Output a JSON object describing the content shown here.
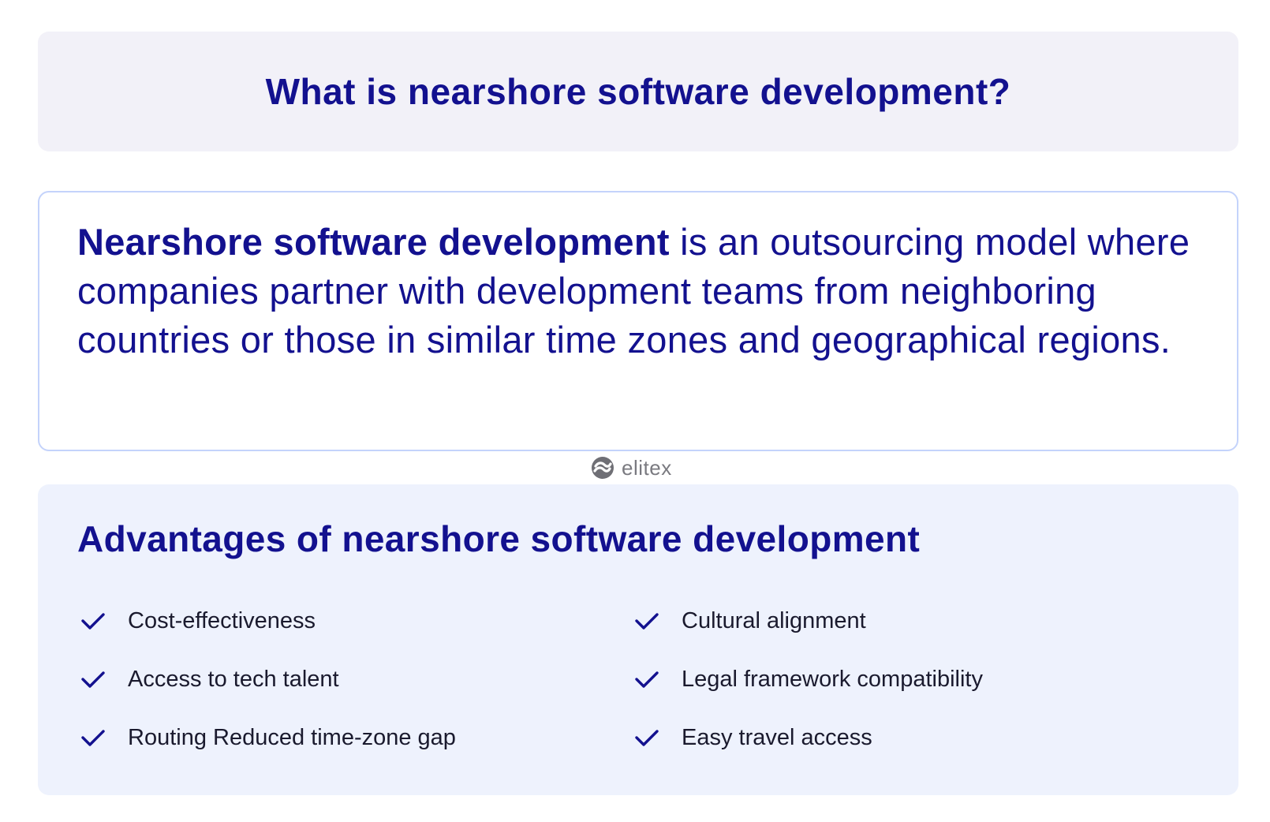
{
  "title": "What is nearshore software development?",
  "definition": {
    "term": "Nearshore software development",
    "text": " is an outsourcing model where companies partner with development teams from neighboring countries or those in similar time zones and geographical regions."
  },
  "brand": {
    "name": "elitex",
    "icon": "elitex-logo-icon"
  },
  "advantages": {
    "heading": "Advantages of nearshore software development",
    "items": [
      "Cost-effectiveness",
      "Cultural alignment",
      "Access to tech talent",
      "Legal framework compatibility",
      "Routing Reduced time-zone gap",
      "Easy travel access"
    ],
    "icon": "checkmark-icon"
  },
  "colors": {
    "accent": "#13118f",
    "title_bg": "#f2f1f8",
    "advantages_bg": "#eef2fd",
    "definition_border": "#c4d3fb",
    "brand_gray": "#7a7a80"
  }
}
